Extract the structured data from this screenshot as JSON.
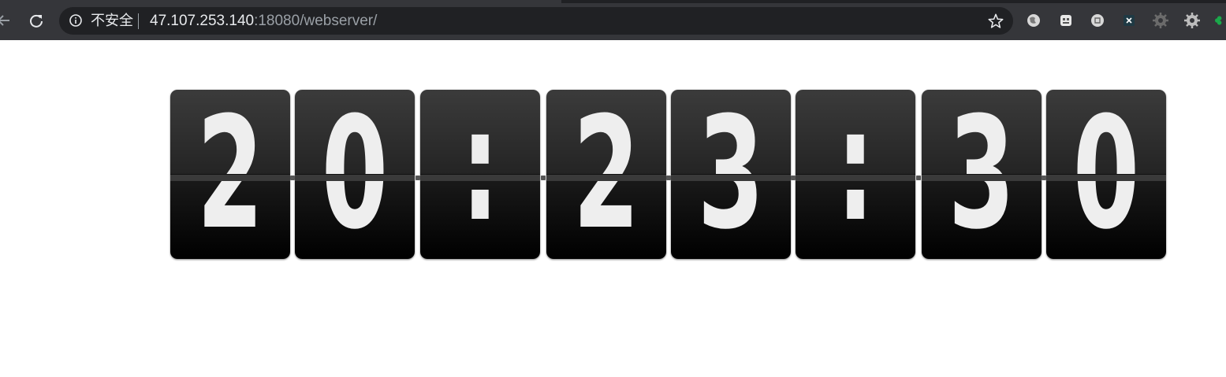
{
  "browser": {
    "security_label": "不安全",
    "url_host": "47.107.253.140",
    "url_rest": ":18080/webserver/",
    "icons": {
      "back": "back-arrow-icon",
      "reload": "reload-icon",
      "info": "info-icon",
      "bookmark": "star-icon",
      "extensions": [
        "globe-extension-icon",
        "robot-extension-icon",
        "command-extension-icon",
        "x-extension-icon",
        "gear-extension-icon",
        "settings-extension-icon",
        "clover-extension-icon"
      ]
    },
    "colors": {
      "toolbar": "#35363a",
      "omnibox": "#202124",
      "text": "#e8eaed",
      "text_dim": "#9aa0a6"
    }
  },
  "clock": {
    "time": "20:23:30",
    "cards": [
      "2",
      "0",
      ":",
      "2",
      "3",
      ":",
      "3",
      "0"
    ],
    "colors": {
      "card_top": "#3b3b3b",
      "card_bottom": "#000000",
      "digit": "#eeeeee"
    }
  }
}
